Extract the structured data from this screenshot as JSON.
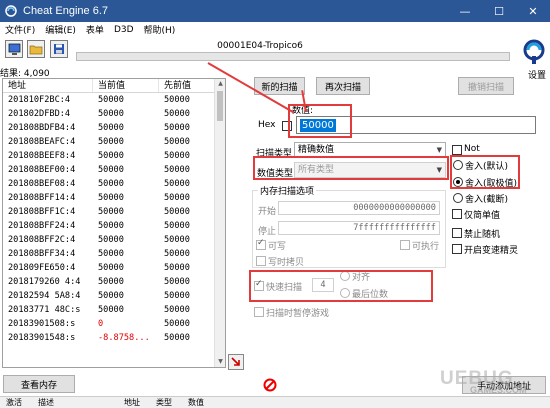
{
  "window": {
    "title": "Cheat Engine 6.7",
    "controls": [
      "—",
      "☐",
      "✕"
    ]
  },
  "menu": [
    "文件(F)",
    "编辑(E)",
    "表单",
    "D3D",
    "帮助(H)"
  ],
  "process": "00001E04-Tropico6",
  "settings_label": "设置",
  "found": "结果: 4,090",
  "results": {
    "headers": [
      "地址",
      "当前值",
      "先前值"
    ],
    "rows": [
      [
        "201810F2BC:4",
        "50000",
        "50000"
      ],
      [
        "201802DFBD:4",
        "50000",
        "50000"
      ],
      [
        "201808BDFB4:4",
        "50000",
        "50000"
      ],
      [
        "201808BEAFC:4",
        "50000",
        "50000"
      ],
      [
        "201808BEEF8:4",
        "50000",
        "50000"
      ],
      [
        "201808BEF00:4",
        "50000",
        "50000"
      ],
      [
        "201808BEF08:4",
        "50000",
        "50000"
      ],
      [
        "201808BFF14:4",
        "50000",
        "50000"
      ],
      [
        "201808BFF1C:4",
        "50000",
        "50000"
      ],
      [
        "201808BFF24:4",
        "50000",
        "50000"
      ],
      [
        "201808BFF2C:4",
        "50000",
        "50000"
      ],
      [
        "201808BFF34:4",
        "50000",
        "50000"
      ],
      [
        "201809FE650:4",
        "50000",
        "50000"
      ],
      [
        "2018179260 4:4",
        "50000",
        "50000"
      ],
      [
        "20182594 5A8:4",
        "50000",
        "50000"
      ],
      [
        "20183771 48C:s",
        "50000",
        "50000"
      ],
      [
        "20183901508:s",
        "0",
        "50000"
      ],
      [
        "20183901548:s",
        "-8.8758...",
        "50000"
      ]
    ],
    "red_rows": [
      16,
      17
    ]
  },
  "buttons": {
    "first_scan": "新的扫描",
    "next_scan": "再次扫描",
    "undo_scan": "撤销扫描",
    "view_memory": "查看内存",
    "add_manual": "手动添加地址"
  },
  "value_label": "数值:",
  "hex_label": "Hex",
  "value_input": "50000",
  "scan_type": {
    "label": "扫描类型",
    "value": "精确数值"
  },
  "value_type": {
    "label": "数值类型",
    "value": "所有类型"
  },
  "memory_options": {
    "title": "内存扫描选项",
    "start_label": "开始",
    "start_value": "0000000000000000",
    "stop_label": "停止",
    "stop_value": "7fffffffffffffff",
    "writable": "可写",
    "executable": "可执行",
    "copy_on_write": "写时拷贝"
  },
  "fast_scan": {
    "label": "快速扫描",
    "value": "4",
    "align": "对齐",
    "last_digits": "最后位数"
  },
  "pause_game": "扫描时暂停游戏",
  "right_options": {
    "not": "Not",
    "round_default": "舍入(默认)",
    "round_extreme": "舍入(取极值)",
    "truncate": "舍入(截断)",
    "simple_values": "仅简单值",
    "unrandomizer": "禁止随机",
    "speedhack": "开启变速精灵"
  },
  "status": [
    "激活",
    "描述",
    "地址",
    "类型",
    "数值"
  ],
  "watermark": "UEBUG",
  "watermark_sub": "GAMES.COM",
  "colors": {
    "titlebar": "#2b5797",
    "highlight": "#e23b3b",
    "selection": "#0078d7"
  }
}
